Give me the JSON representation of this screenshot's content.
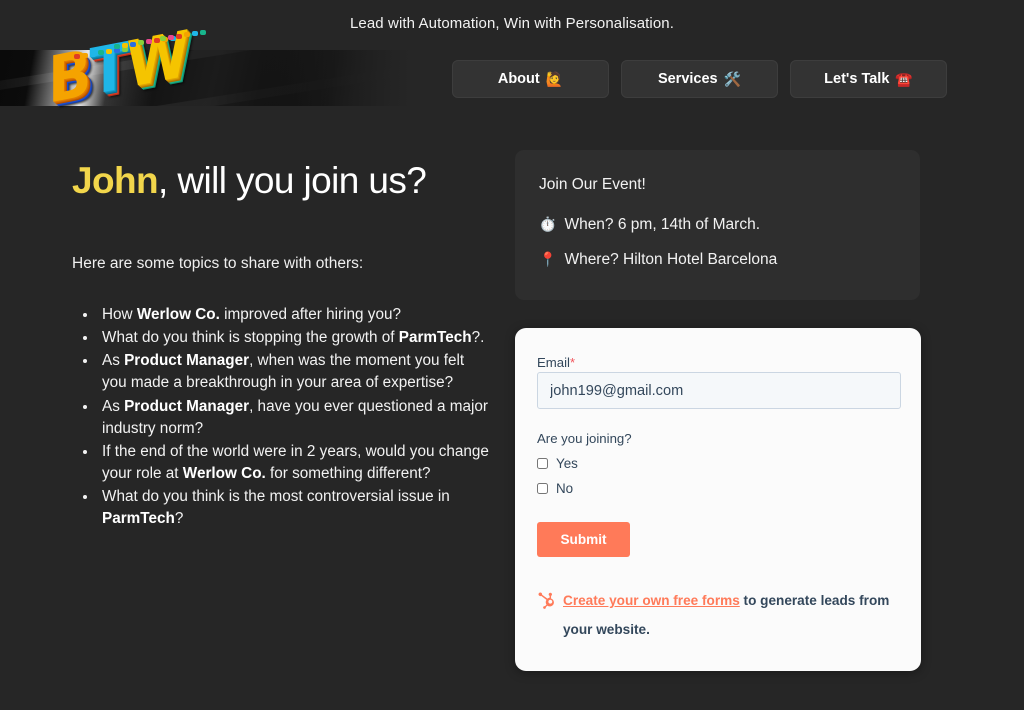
{
  "header": {
    "tagline": "Lead with Automation, Win with Personalisation.",
    "logo_text": "BTW",
    "logo_letters": [
      "B",
      "T",
      "W"
    ],
    "nav": [
      {
        "label": "About",
        "emoji": "🙋",
        "icon": "person-raising-hand-icon"
      },
      {
        "label": "Services",
        "emoji": "🛠️",
        "icon": "hammer-and-wrench-icon"
      },
      {
        "label": "Let's Talk",
        "emoji": "☎️",
        "icon": "telephone-icon"
      }
    ]
  },
  "hero": {
    "name": "John",
    "headline_rest": ", will you join us?",
    "subhead": "Here are some topics to share with others:"
  },
  "topics": [
    {
      "parts": [
        {
          "text": "How ",
          "bold": false
        },
        {
          "text": "Werlow Co.",
          "bold": true
        },
        {
          "text": " improved after hiring you?",
          "bold": false
        }
      ]
    },
    {
      "parts": [
        {
          "text": "What do you think is stopping the growth of ",
          "bold": false
        },
        {
          "text": "ParmTech",
          "bold": true
        },
        {
          "text": "?.",
          "bold": false
        }
      ]
    },
    {
      "parts": [
        {
          "text": "As ",
          "bold": false
        },
        {
          "text": "Product Manager",
          "bold": true
        },
        {
          "text": ", when was the moment you felt you made a breakthrough in your area of expertise?",
          "bold": false
        }
      ]
    },
    {
      "parts": [
        {
          "text": "As ",
          "bold": false
        },
        {
          "text": "Product Manager",
          "bold": true
        },
        {
          "text": ", have you ever questioned a major industry norm?",
          "bold": false
        }
      ]
    },
    {
      "parts": [
        {
          "text": "If the end of the world were in 2 years, would you change your role at ",
          "bold": false
        },
        {
          "text": "Werlow Co.",
          "bold": true
        },
        {
          "text": " for something different?",
          "bold": false
        }
      ]
    },
    {
      "parts": [
        {
          "text": "What do you think is the most controversial issue in ",
          "bold": false
        },
        {
          "text": "ParmTech",
          "bold": true
        },
        {
          "text": "?",
          "bold": false
        }
      ]
    }
  ],
  "event": {
    "title": "Join Our Event!",
    "when_emoji": "⏱️",
    "when_icon": "stopwatch-icon",
    "when": "When? 6 pm, 14th of March.",
    "where_emoji": "📍",
    "where_icon": "round-pushpin-icon",
    "where": "Where? Hilton Hotel Barcelona"
  },
  "form": {
    "email_label": "Email",
    "email_required_marker": "*",
    "email_value": "john199@gmail.com",
    "email_placeholder": "",
    "question_label": "Are you joining?",
    "options": [
      {
        "label": "Yes",
        "checked": false
      },
      {
        "label": "No",
        "checked": false
      }
    ],
    "submit_label": "Submit",
    "footer_link": "Create your own free forms",
    "footer_text": " to generate leads from your website.",
    "footer_icon": "hubspot-sprocket-icon"
  },
  "colors": {
    "page_background": "#262626",
    "card_background": "#2e2e2e",
    "form_background": "#fbfbfb",
    "accent_yellow": "#f2d64b",
    "accent_orange": "#ff7a59",
    "required_red": "#f2545b",
    "nav_button": "#333333",
    "form_text": "#33475b",
    "input_background": "#f5f8fa"
  }
}
